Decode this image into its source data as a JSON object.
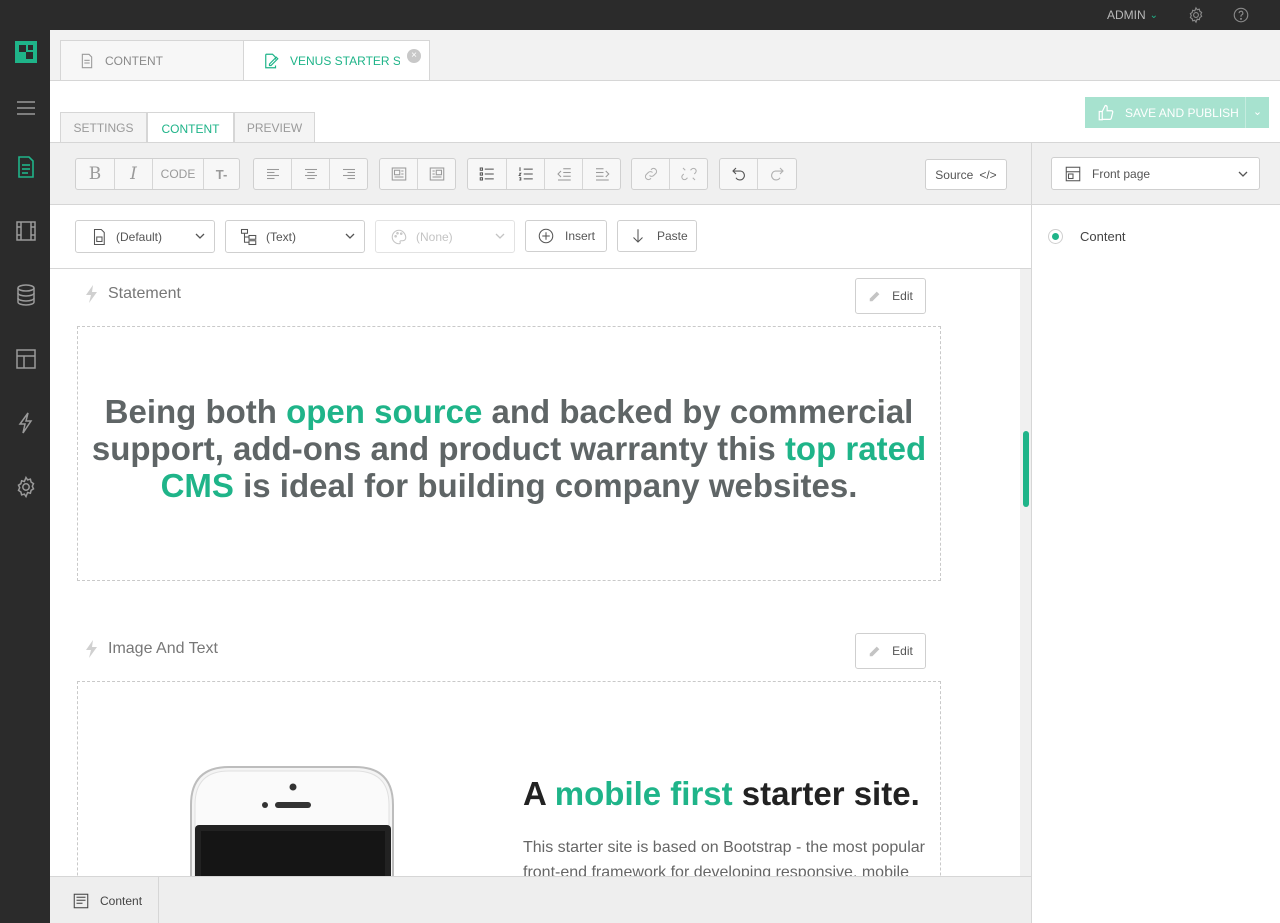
{
  "topbar": {
    "user_label": "ADMIN"
  },
  "rail": {
    "icons": [
      "logo-icon",
      "menu-icon",
      "content-icon",
      "media-icon",
      "database-icon",
      "layout-icon",
      "lightning-icon",
      "settings-icon"
    ]
  },
  "doc_tabs": [
    {
      "label": "CONTENT"
    },
    {
      "label": "VENUS STARTER SITE"
    }
  ],
  "sub_tabs": [
    {
      "label": "SETTINGS"
    },
    {
      "label": "CONTENT"
    },
    {
      "label": "PREVIEW"
    }
  ],
  "publish": {
    "label": "SAVE AND PUBLISH"
  },
  "toolbar": {
    "code_label": "CODE",
    "source_label": "Source",
    "source_symbol": "</>"
  },
  "toolbar2": {
    "style_value": "(Default)",
    "format_value": "(Text)",
    "color_value": "(None)",
    "insert_label": "Insert",
    "paste_label": "Paste"
  },
  "blocks": {
    "statement": {
      "title": "Statement",
      "edit_label": "Edit",
      "text": {
        "p1": "Being both ",
        "g1": "open source",
        "p2": " and backed by commercial support, add-ons and product warranty this ",
        "g2": "top rated CMS",
        "p3": " is ideal for building company websites."
      }
    },
    "image_and_text": {
      "title": "Image And Text",
      "edit_label": "Edit",
      "heading": {
        "p1": "A ",
        "g1": "mobile first",
        "p2": " starter site."
      },
      "body": "This starter site is based on Bootstrap - the most popular front-end framework for developing responsive, mobile first"
    }
  },
  "statusbar": {
    "label": "Content"
  },
  "right_panel": {
    "selector_value": "Front page",
    "tree": [
      {
        "label": "Content",
        "selected": true
      }
    ]
  },
  "colors": {
    "accent": "#1fb489",
    "dark": "#2b2b2b",
    "publish_disabled": "#a7e2cf"
  }
}
